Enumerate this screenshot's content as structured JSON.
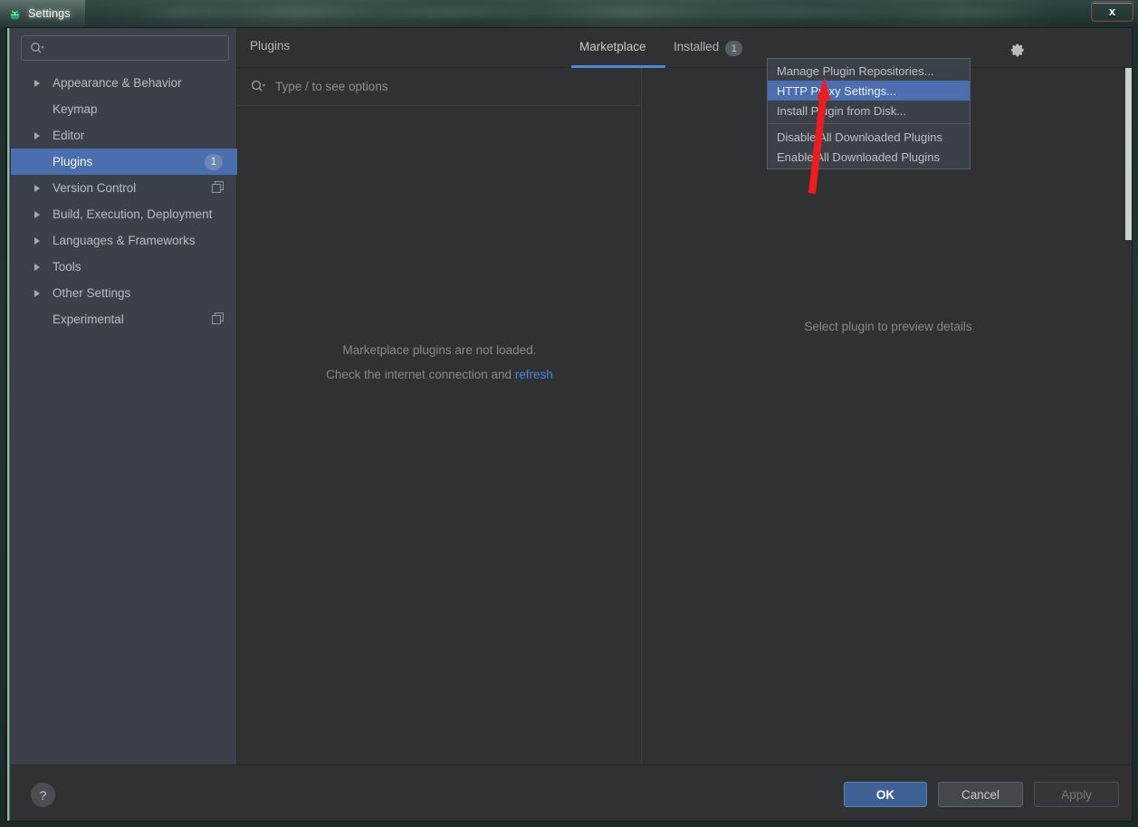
{
  "window": {
    "title": "Settings",
    "app_icon": "android-studio-icon",
    "close_label": "x"
  },
  "sidebar": {
    "search": {
      "placeholder": "",
      "icon": "search-icon"
    },
    "items": [
      {
        "label": "Appearance & Behavior",
        "expandable": true,
        "badge": null,
        "copy_icon": false
      },
      {
        "label": "Keymap",
        "expandable": false,
        "badge": null,
        "copy_icon": false
      },
      {
        "label": "Editor",
        "expandable": true,
        "badge": null,
        "copy_icon": false
      },
      {
        "label": "Plugins",
        "expandable": false,
        "badge": "1",
        "copy_icon": false,
        "selected": true
      },
      {
        "label": "Version Control",
        "expandable": true,
        "badge": null,
        "copy_icon": true
      },
      {
        "label": "Build, Execution, Deployment",
        "expandable": true,
        "badge": null,
        "copy_icon": false
      },
      {
        "label": "Languages & Frameworks",
        "expandable": true,
        "badge": null,
        "copy_icon": false
      },
      {
        "label": "Tools",
        "expandable": true,
        "badge": null,
        "copy_icon": false
      },
      {
        "label": "Other Settings",
        "expandable": true,
        "badge": null,
        "copy_icon": false
      },
      {
        "label": "Experimental",
        "expandable": false,
        "badge": null,
        "copy_icon": true
      }
    ]
  },
  "header": {
    "panel_title": "Plugins",
    "tabs": [
      {
        "label": "Marketplace",
        "badge": null,
        "active": true
      },
      {
        "label": "Installed",
        "badge": "1",
        "active": false
      }
    ],
    "gear_icon": "gear-icon"
  },
  "center": {
    "search_placeholder": "Type / to see options",
    "search_icon": "search-icon",
    "empty_line1": "Marketplace plugins are not loaded.",
    "empty_line2_prefix": "Check the internet connection and ",
    "empty_refresh_link": "refresh"
  },
  "right": {
    "empty_message": "Select plugin to preview details"
  },
  "menu": {
    "items": [
      {
        "label": "Manage Plugin Repositories...",
        "highlighted": false,
        "separator_after": false
      },
      {
        "label": "HTTP Proxy Settings...",
        "highlighted": true,
        "separator_after": false
      },
      {
        "label": "Install Plugin from Disk...",
        "highlighted": false,
        "separator_after": true
      },
      {
        "label": "Disable All Downloaded Plugins",
        "highlighted": false,
        "separator_after": false
      },
      {
        "label": "Enable All Downloaded Plugins",
        "highlighted": false,
        "separator_after": false
      }
    ]
  },
  "footer": {
    "help_label": "?",
    "ok_label": "OK",
    "cancel_label": "Cancel",
    "apply_label": "Apply"
  },
  "colors": {
    "accent_blue": "#4b87d4",
    "selection_blue": "#4a6eae",
    "panel_bg": "#2f3133",
    "sidebar_bg": "#3c4149",
    "annotation_red": "#ee1c1c"
  }
}
